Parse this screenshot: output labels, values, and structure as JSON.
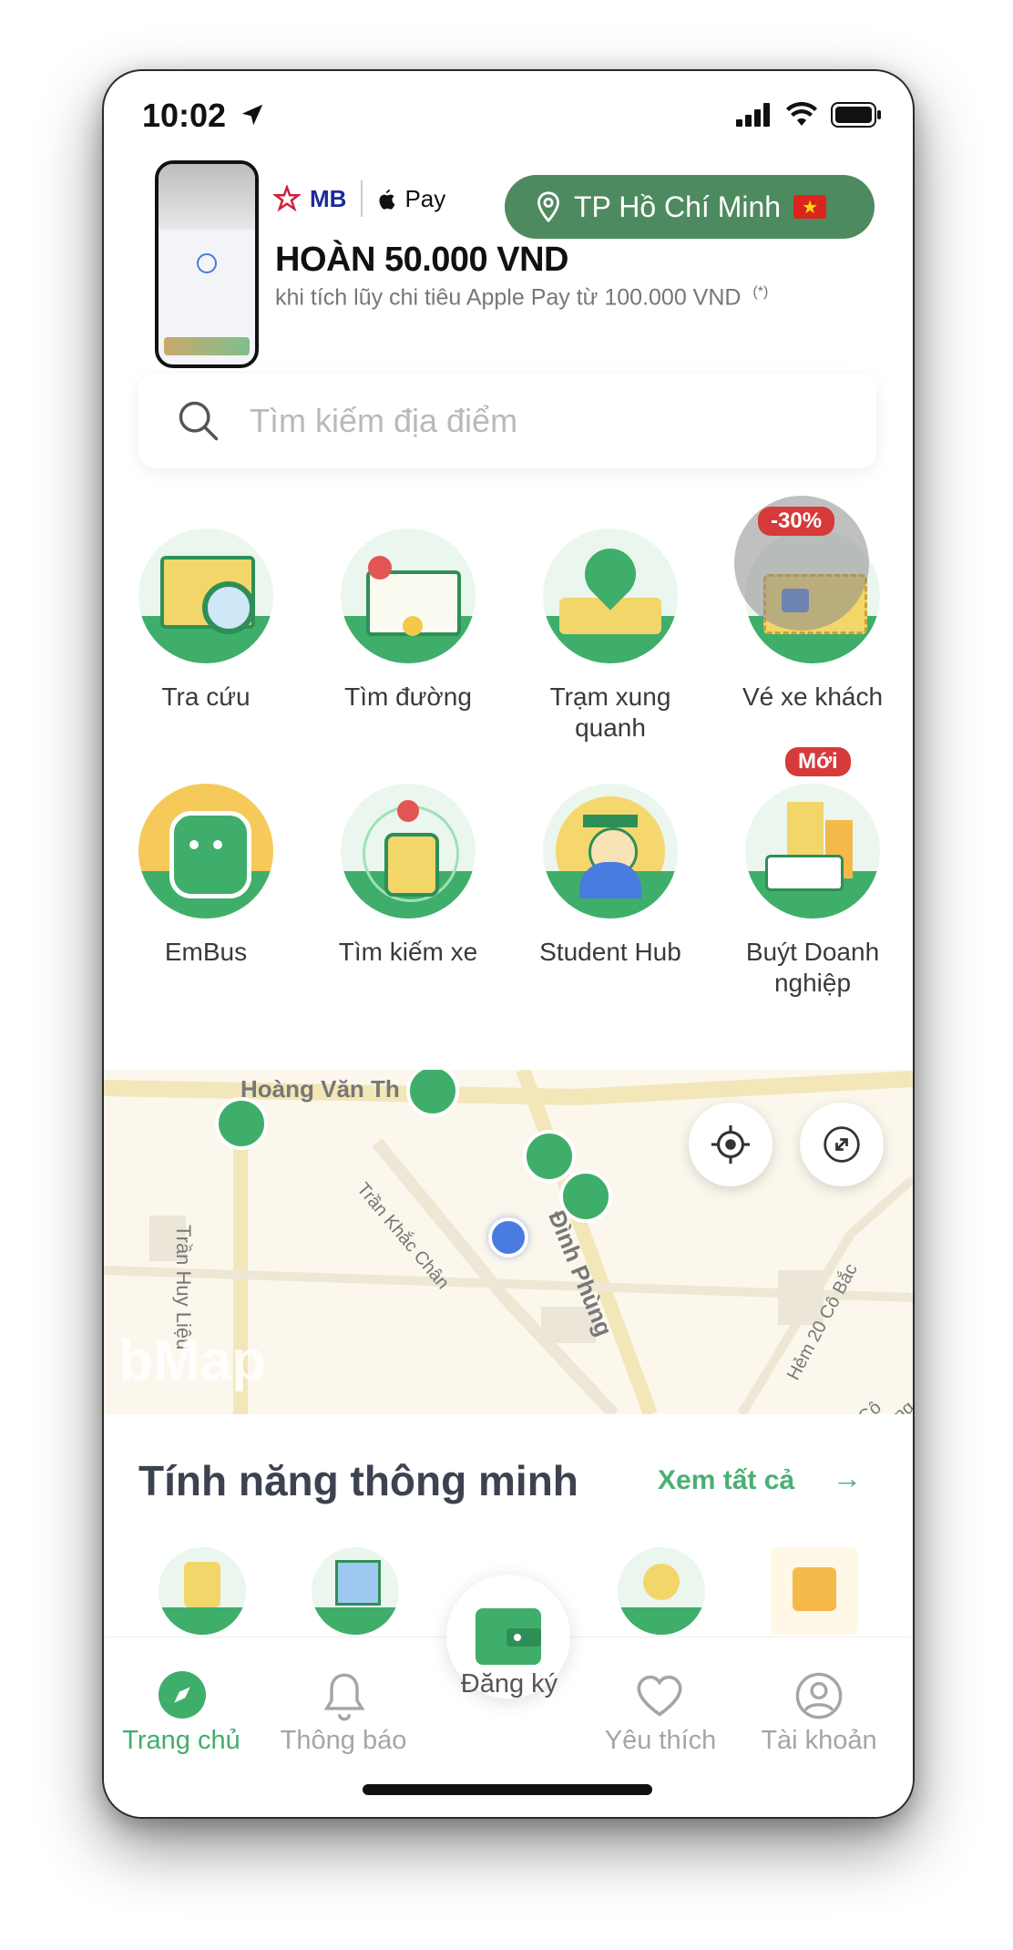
{
  "status": {
    "time": "10:02"
  },
  "promo": {
    "bank": "MB",
    "pay": "Pay",
    "title": "HOÀN 50.000 VND",
    "subtitle": "khi tích lũy chi tiêu Apple Pay từ 100.000 VND",
    "footnote": "(*)"
  },
  "city_button": {
    "label": "TP Hồ Chí Minh"
  },
  "search": {
    "placeholder": "Tìm kiếm địa điểm"
  },
  "features": [
    {
      "label": "Tra cứu",
      "icon": "map-search-icon"
    },
    {
      "label": "Tìm đường",
      "icon": "route-icon"
    },
    {
      "label": "Trạm xung quanh",
      "icon": "nearby-stations-icon"
    },
    {
      "label": "Vé xe khách",
      "icon": "bus-ticket-icon",
      "badge": "-30%"
    },
    {
      "label": "EmBus",
      "icon": "embus-icon"
    },
    {
      "label": "Tìm kiếm xe",
      "icon": "find-bus-icon"
    },
    {
      "label": "Student Hub",
      "icon": "student-icon"
    },
    {
      "label": "Buýt Doanh nghiệp",
      "icon": "business-bus-icon",
      "badge": "Mới"
    }
  ],
  "map": {
    "streets": [
      "Hoàng Văn Th",
      "Trần Huy Liệu",
      "Trần Khắc Chân",
      "Đình Phùng",
      "Hẻm 20 Cô Bắc",
      "Cô Giang"
    ],
    "watermark": "bMap"
  },
  "smart_features": {
    "title": "Tính năng thông minh",
    "see_all": "Xem tất cả"
  },
  "tabbar": {
    "home": "Trang chủ",
    "notifications": "Thông báo",
    "register": "Đăng ký",
    "favorites": "Yêu thích",
    "account": "Tài khoản"
  },
  "colors": {
    "brand_green": "#3fae6b",
    "city_button": "#4e8a5f",
    "badge_red": "#d63a3a"
  }
}
